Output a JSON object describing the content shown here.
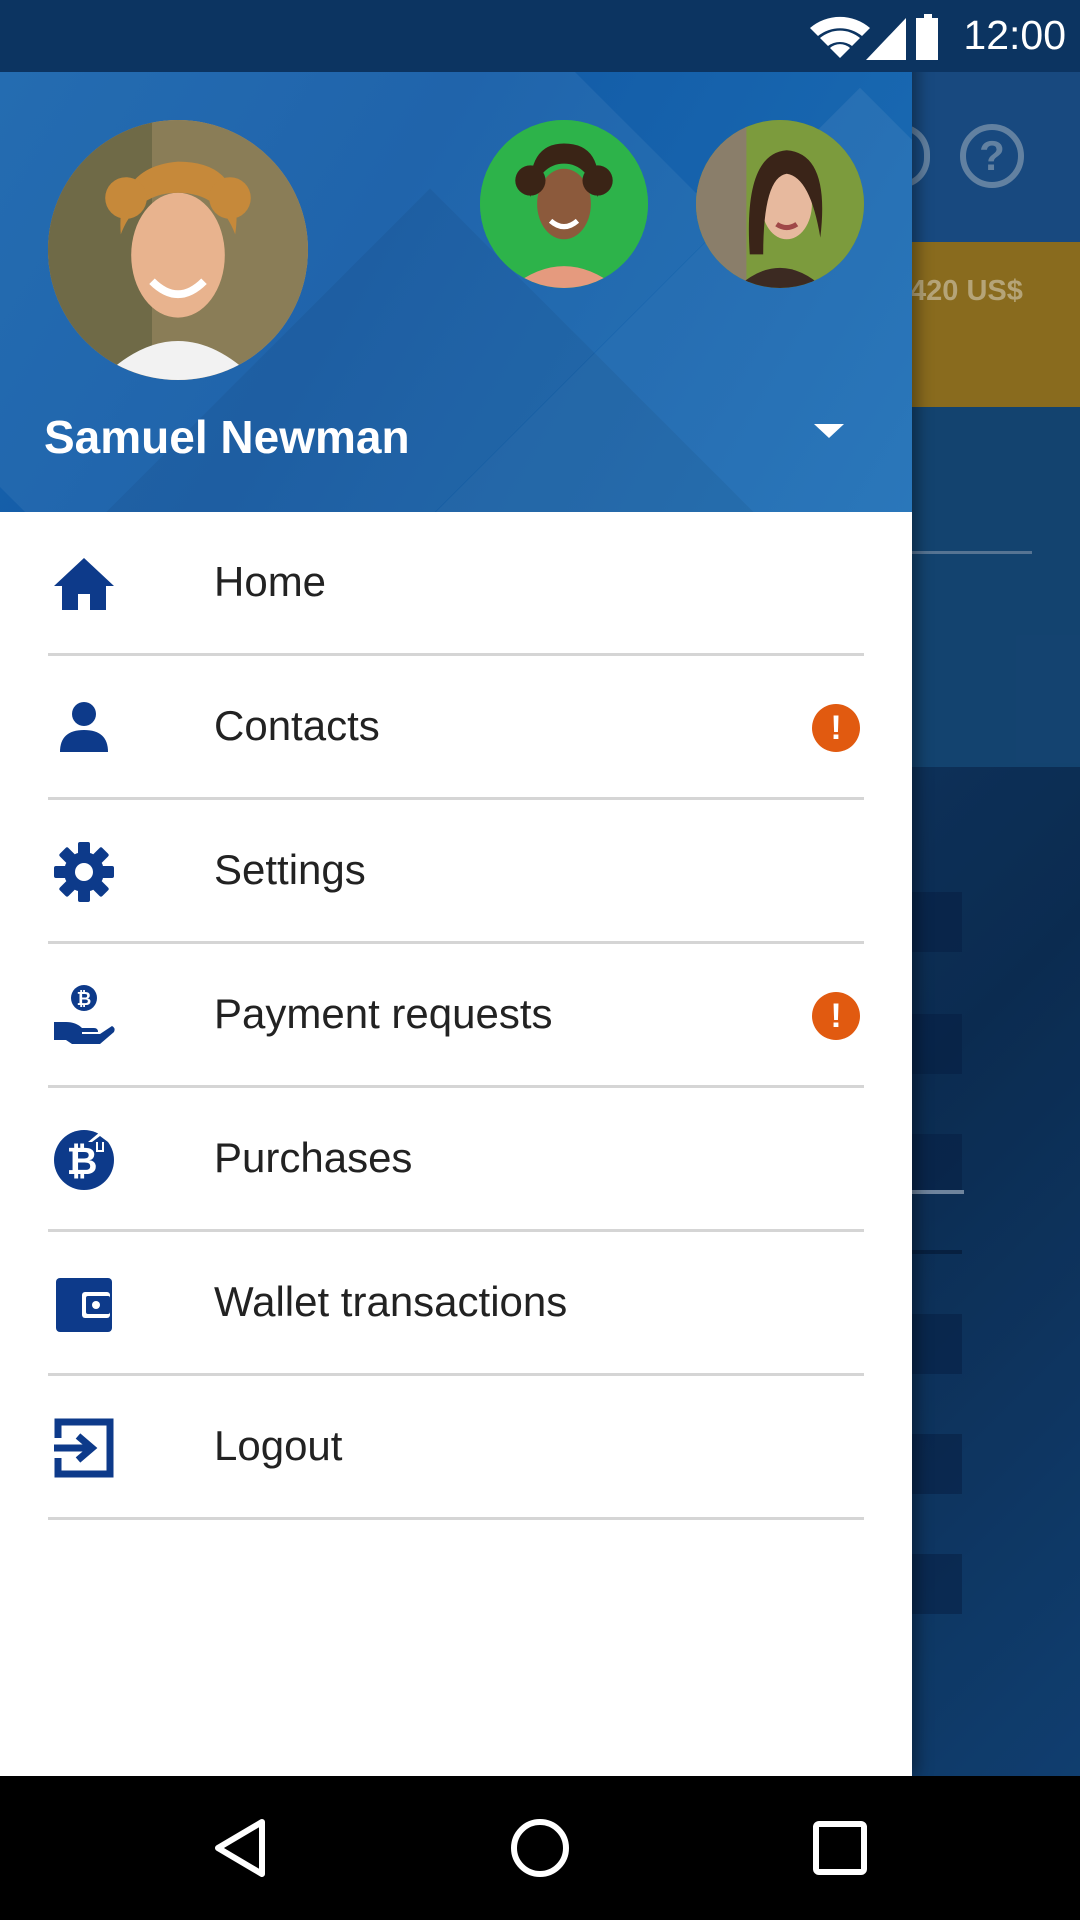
{
  "status_bar": {
    "time": "12:00"
  },
  "background_app": {
    "amount_partial": "420 US$"
  },
  "drawer": {
    "user": {
      "name": "Samuel Newman"
    },
    "menu": [
      {
        "label": "Home",
        "icon": "home-icon",
        "alert": false
      },
      {
        "label": "Contacts",
        "icon": "person-icon",
        "alert": true
      },
      {
        "label": "Settings",
        "icon": "gear-icon",
        "alert": false
      },
      {
        "label": "Payment requests",
        "icon": "bitcoin-hand-icon",
        "alert": true
      },
      {
        "label": "Purchases",
        "icon": "bitcoin-purchase-icon",
        "alert": false
      },
      {
        "label": "Wallet transactions",
        "icon": "wallet-icon",
        "alert": false
      },
      {
        "label": "Logout",
        "icon": "logout-icon",
        "alert": false
      }
    ],
    "alert_symbol": "!"
  },
  "colors": {
    "accent": "#0d3a8a",
    "header": "#1763ad",
    "alert": "#e15a10"
  }
}
